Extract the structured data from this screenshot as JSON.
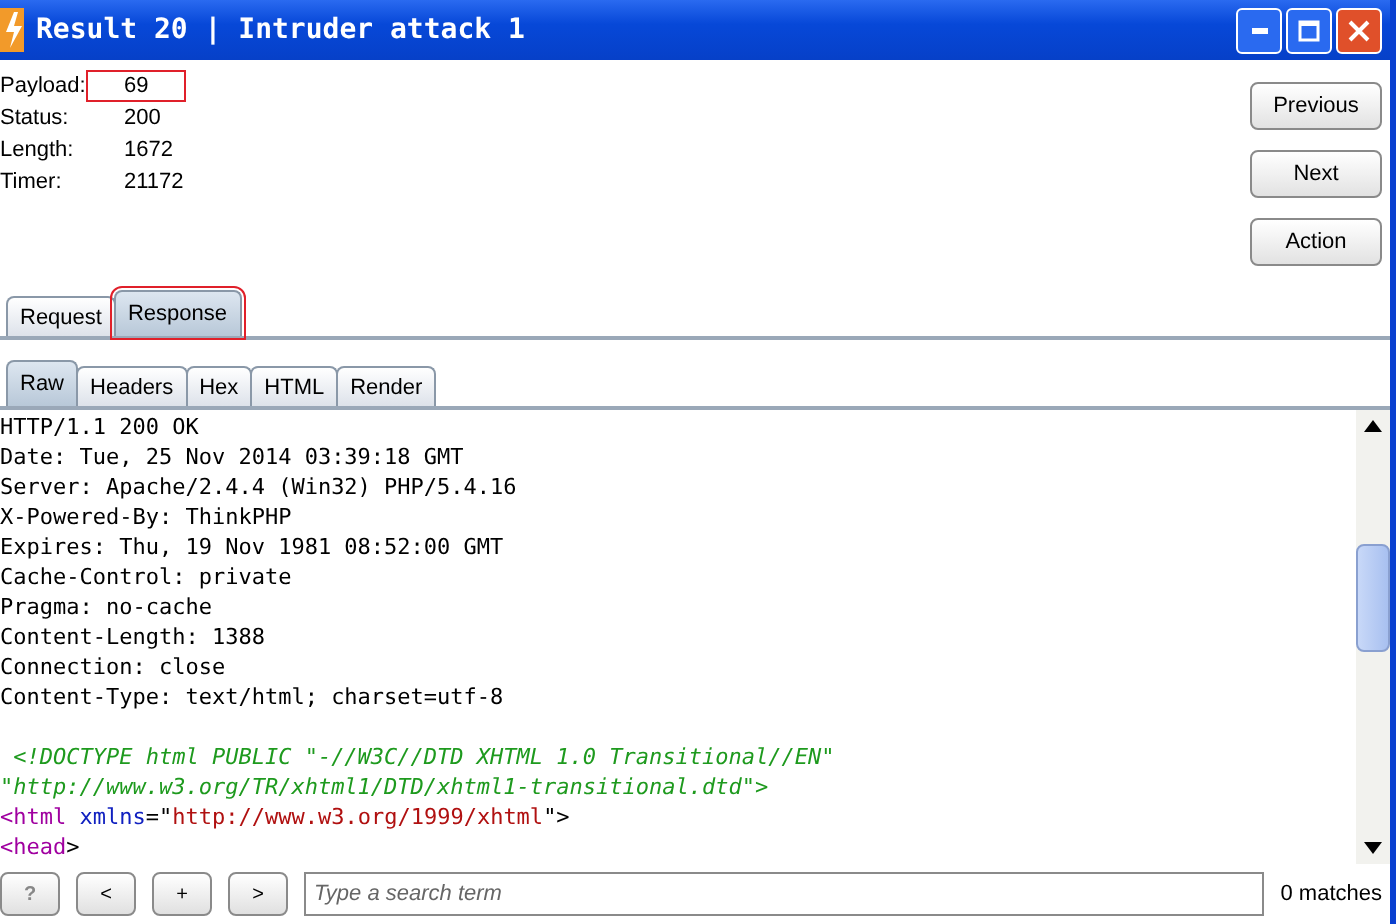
{
  "window": {
    "title": "Result 20 | Intruder attack 1"
  },
  "fields": [
    {
      "label": "Payload:",
      "value": "69",
      "highlighted": true
    },
    {
      "label": "Status:",
      "value": "200",
      "highlighted": false
    },
    {
      "label": "Length:",
      "value": "1672",
      "highlighted": false
    },
    {
      "label": "Timer:",
      "value": "21172",
      "highlighted": false
    }
  ],
  "actions": [
    "Previous",
    "Next",
    "Action"
  ],
  "tabs": [
    {
      "label": "Request",
      "selected": false,
      "highlighted": false
    },
    {
      "label": "Response",
      "selected": true,
      "highlighted": true
    }
  ],
  "view_tabs": [
    {
      "label": "Raw",
      "selected": true
    },
    {
      "label": "Headers",
      "selected": false
    },
    {
      "label": "Hex",
      "selected": false
    },
    {
      "label": "HTML",
      "selected": false
    },
    {
      "label": "Render",
      "selected": false
    }
  ],
  "content": [
    [
      {
        "kind": "plain",
        "text": "HTTP/1.1 200 OK"
      }
    ],
    [
      {
        "kind": "plain",
        "text": "Date: Tue, 25 Nov 2014 03:39:18 GMT"
      }
    ],
    [
      {
        "kind": "plain",
        "text": "Server: Apache/2.4.4 (Win32) PHP/5.4.16"
      }
    ],
    [
      {
        "kind": "plain",
        "text": "X-Powered-By: ThinkPHP"
      }
    ],
    [
      {
        "kind": "plain",
        "text": "Expires: Thu, 19 Nov 1981 08:52:00 GMT"
      }
    ],
    [
      {
        "kind": "plain",
        "text": "Cache-Control: private"
      }
    ],
    [
      {
        "kind": "plain",
        "text": "Pragma: no-cache"
      }
    ],
    [
      {
        "kind": "plain",
        "text": "Content-Length: 1388"
      }
    ],
    [
      {
        "kind": "plain",
        "text": "Connection: close"
      }
    ],
    [
      {
        "kind": "plain",
        "text": "Content-Type: text/html; charset=utf-8"
      }
    ],
    [
      {
        "kind": "doctype",
        "text": " <!DOCTYPE html PUBLIC \"-//W3C//DTD XHTML 1.0 Transitional//EN\""
      }
    ],
    [
      {
        "kind": "doctype",
        "text": "\"http://www.w3.org/TR/xhtml1/DTD/xhtml1-transitional.dtd\">"
      }
    ],
    [
      {
        "kind": "tag",
        "text": "<html"
      },
      {
        "kind": "attr",
        "text": " xmlns"
      },
      {
        "kind": "plain",
        "text": "=\""
      },
      {
        "kind": "value",
        "text": "http://www.w3.org/1999/xhtml"
      },
      {
        "kind": "plain",
        "text": "\">"
      }
    ],
    [
      {
        "kind": "tag",
        "text": "<head"
      },
      {
        "kind": "plain",
        "text": ">"
      }
    ]
  ],
  "search": {
    "help": "?",
    "prev": "<",
    "add": "+",
    "next": ">",
    "placeholder": "Type a search term",
    "matches": "0 matches"
  }
}
